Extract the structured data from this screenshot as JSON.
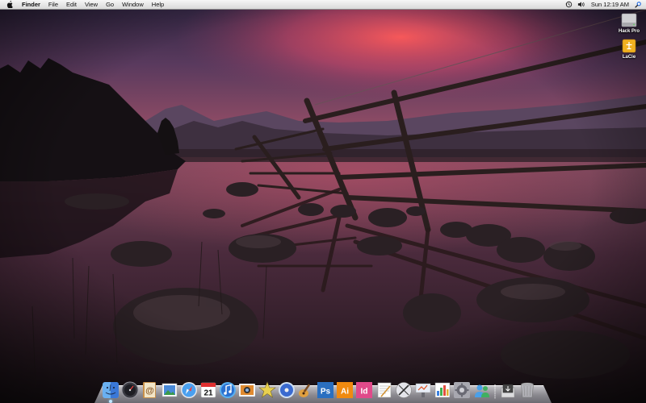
{
  "menubar": {
    "app_name": "Finder",
    "menus": [
      "File",
      "Edit",
      "View",
      "Go",
      "Window",
      "Help"
    ],
    "clock": "Sun 12:19 AM",
    "status_icons": [
      "time-machine-icon",
      "volume-icon",
      "spotlight-icon"
    ]
  },
  "desktop": {
    "volumes": [
      {
        "label": "Hack Pro",
        "icon": "hard-drive-icon"
      },
      {
        "label": "LaCie",
        "icon": "external-drive-icon"
      }
    ]
  },
  "dock": {
    "apps": [
      {
        "name": "finder",
        "running": true
      },
      {
        "name": "dashboard",
        "running": false
      },
      {
        "name": "address-book",
        "running": false
      },
      {
        "name": "preview",
        "running": false
      },
      {
        "name": "safari",
        "running": false
      },
      {
        "name": "ical",
        "running": false,
        "day": "21"
      },
      {
        "name": "itunes",
        "running": false
      },
      {
        "name": "iphoto",
        "running": false
      },
      {
        "name": "imovie",
        "running": false
      },
      {
        "name": "dvd-player",
        "running": false
      },
      {
        "name": "garageband",
        "running": false
      },
      {
        "name": "photoshop",
        "running": false,
        "glyph": "Ps"
      },
      {
        "name": "illustrator",
        "running": false,
        "glyph": "Ai"
      },
      {
        "name": "indesign",
        "running": false,
        "glyph": "Id"
      },
      {
        "name": "textedit",
        "running": false
      },
      {
        "name": "script-editor",
        "running": false
      },
      {
        "name": "keynote",
        "running": false
      },
      {
        "name": "activity-monitor",
        "running": false
      },
      {
        "name": "system-preferences",
        "running": false
      },
      {
        "name": "ichat",
        "running": false
      }
    ],
    "trailing": [
      {
        "name": "downloads-stack"
      },
      {
        "name": "trash"
      }
    ]
  },
  "colors": {
    "sky_top": "#3a2a4a",
    "sky_glow": "#e85a6a",
    "water": "#4a2a3a",
    "photoshop": "#2a6fc0",
    "illustrator": "#f08a10",
    "indesign": "#e04a8a"
  }
}
